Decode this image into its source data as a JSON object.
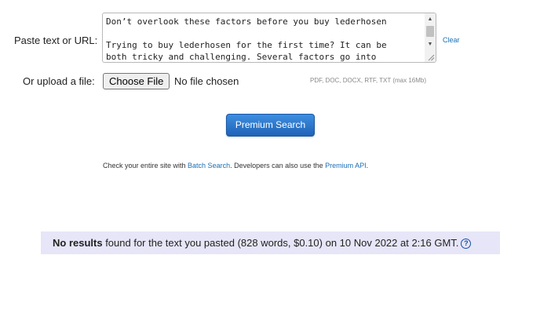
{
  "form": {
    "paste_label": "Paste text or URL:",
    "textarea_lines": [
      "Don’t overlook these factors before you buy lederhosen",
      "",
      "Trying to buy lederhosen for the first time? It can be",
      "both tricky and challenging. Several factors go into"
    ],
    "clear_label": "Clear",
    "upload_label": "Or upload a file:",
    "file_button_label": "Choose File",
    "file_status": "No file chosen",
    "file_hint": "PDF, DOC, DOCX, RTF, TXT (max 16Mb)",
    "submit_label": "Premium Search"
  },
  "info": {
    "prefix": "Check your entire site with ",
    "batch_link": "Batch Search",
    "middle": ". Developers can also use the ",
    "api_link": "Premium API",
    "suffix": "."
  },
  "result": {
    "bold": "No results",
    "text": " found for the text you pasted (828 words, $0.10) on 10 Nov 2022 at 2:16 GMT.",
    "help_glyph": "?"
  },
  "icons": {
    "scroll_up": "scroll-up-arrow-icon",
    "scroll_down": "scroll-down-arrow-icon",
    "resize": "resize-grip-icon",
    "help": "question-circle-icon"
  },
  "colors": {
    "link": "#1a6fb5",
    "button_top": "#3d8ee0",
    "button_bottom": "#1f63b8",
    "result_bg": "#e6e6f8",
    "help_icon": "#1a4fa0"
  }
}
